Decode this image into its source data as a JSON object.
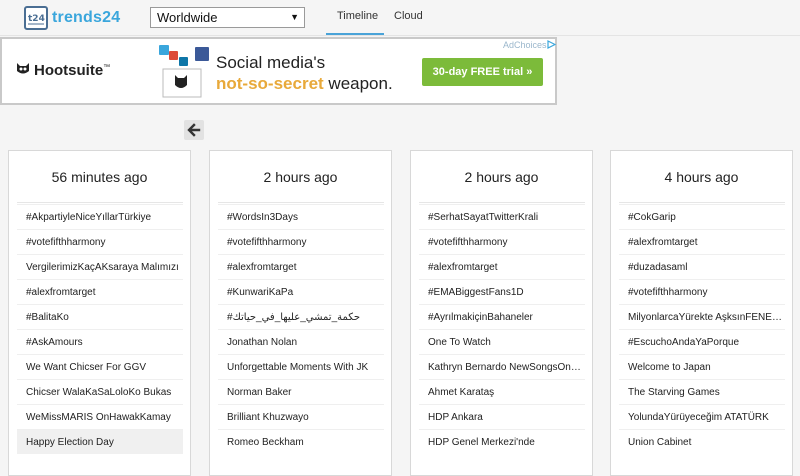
{
  "brand": {
    "name": "trends24"
  },
  "region_select": {
    "value": "Worldwide"
  },
  "tabs": [
    {
      "label": "Timeline"
    },
    {
      "label": "Cloud"
    }
  ],
  "ad": {
    "brand": "Hootsuite",
    "headline_1": "Social media's",
    "headline_2_accent": "not-so-secret",
    "headline_2_rest": " weapon.",
    "cta": "30-day FREE trial »",
    "ad_choices": "AdChoices"
  },
  "colors": {
    "brand_blue": "#3aa6dc",
    "tab_underline": "#4aa3d8",
    "cta_green": "#7cbb3a",
    "accent_orange": "#e8a93a"
  },
  "columns": [
    {
      "time": "56 minutes ago",
      "trends": [
        "#AkpartiyleNiceYıllarTürkiye",
        "#votefifthharmony",
        "VergilerimizKaçAKsaraya Malımızı",
        "#alexfromtarget",
        "#BalitaKo",
        "#AskAmours",
        "We Want Chicser For GGV",
        "Chicser WalaKaSaLoloKo Bukas",
        "WeMissMARIS OnHawakKamay",
        "Happy Election Day"
      ]
    },
    {
      "time": "2 hours ago",
      "trends": [
        "#WordsIn3Days",
        "#votefifthharmony",
        "#alexfromtarget",
        "#KunwariKaPa",
        "#حكمة_تمشي_عليها_في_حياتك",
        "Jonathan Nolan",
        "Unforgettable Moments With JK",
        "Norman Baker",
        "Brilliant Khuzwayo",
        "Romeo Beckham"
      ]
    },
    {
      "time": "2 hours ago",
      "trends": [
        "#SerhatSayatTwitterKrali",
        "#votefifthharmony",
        "#alexfromtarget",
        "#EMABiggestFans1D",
        "#AyrılmakiçinBahaneler",
        "One To Watch",
        "Kathryn Bernardo NewSongsOnSpotify",
        "Ahmet Karataş",
        "HDP Ankara",
        "HDP Genel Merkezi'nde"
      ]
    },
    {
      "time": "4 hours ago",
      "trends": [
        "#CokGarip",
        "#alexfromtarget",
        "#duzadasaml",
        "#votefifthharmony",
        "MilyonlarcaYürekte AşksınFENERBAHÇE",
        "#EscuchoAndaYaPorque",
        "Welcome to Japan",
        "The Starving Games",
        "YolundaYürüyeceğim ATATÜRK",
        "Union Cabinet"
      ]
    }
  ]
}
